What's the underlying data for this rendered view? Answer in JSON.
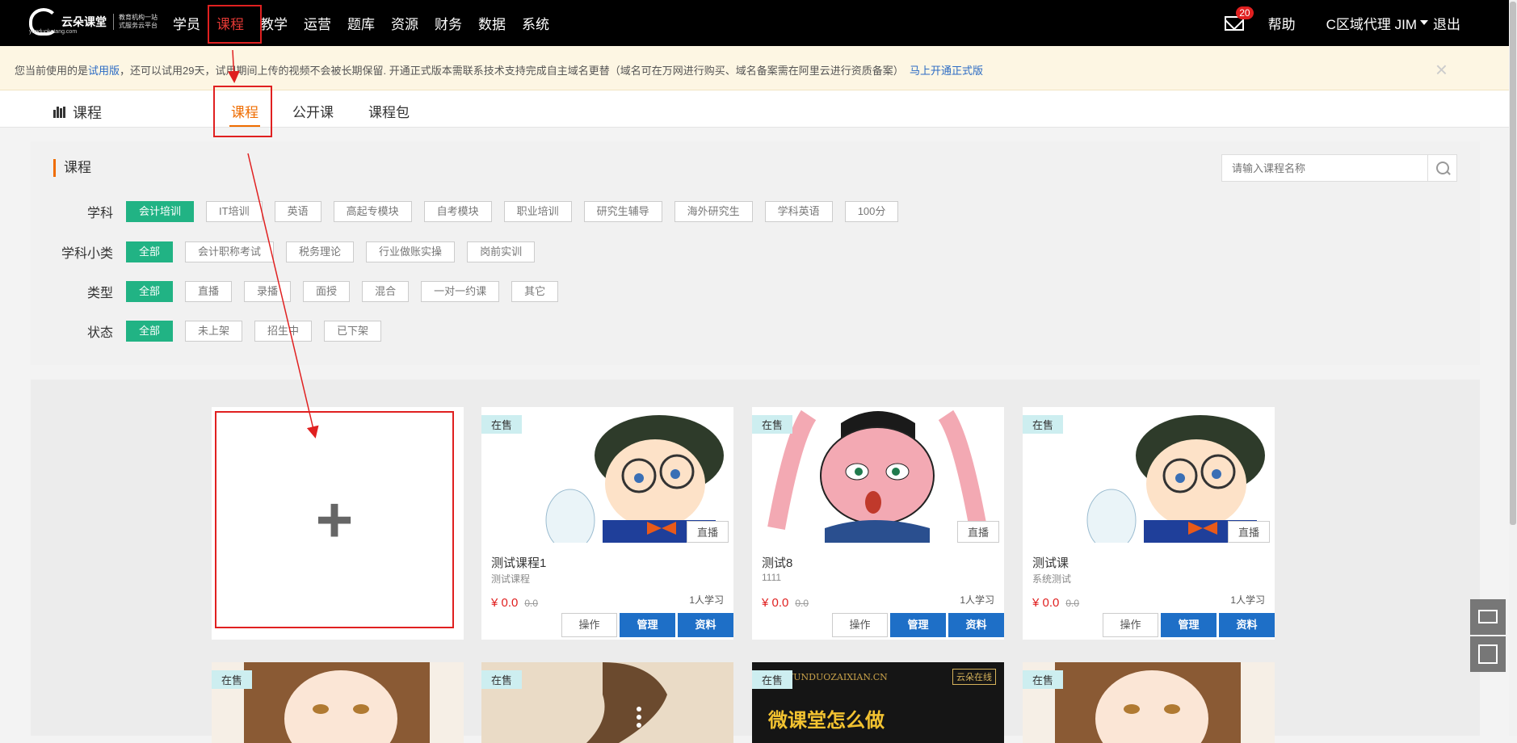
{
  "topbar": {
    "logo_name": "云朵课堂",
    "logo_tagline_1": "教育机构一站",
    "logo_tagline_2": "式服务云平台",
    "logo_url": "yunduoketang.com",
    "nav": [
      "学员",
      "课程",
      "教学",
      "运营",
      "题库",
      "资源",
      "财务",
      "数据",
      "系统"
    ],
    "active_nav": "课程",
    "mail_badge": "20",
    "help": "帮助",
    "user": "C区域代理 JIM",
    "logout": "退出"
  },
  "notice": {
    "part1": "您当前使用的是",
    "trial_link": "试用版",
    "part2": "，还可以试用29天，试用期间上传的视频不会被长期保留. 开通正式版本需联系技术支持完成自主域名更替（域名可在万网进行购买、域名备案需在阿里云进行资质备案）",
    "upgrade_link": "马上开通正式版",
    "close": "×"
  },
  "subnav": {
    "title": "课程",
    "tabs": [
      "课程",
      "公开课",
      "课程包"
    ]
  },
  "filter": {
    "title": "课程",
    "search_placeholder": "请输入课程名称",
    "rows": [
      {
        "label": "学科",
        "chips": [
          "会计培训",
          "IT培训",
          "英语",
          "高起专模块",
          "自考模块",
          "职业培训",
          "研究生辅导",
          "海外研究生",
          "学科英语",
          "100分"
        ]
      },
      {
        "label": "学科小类",
        "chips": [
          "全部",
          "会计职称考试",
          "税务理论",
          "行业做账实操",
          "岗前实训"
        ]
      },
      {
        "label": "类型",
        "chips": [
          "全部",
          "直播",
          "录播",
          "面授",
          "混合",
          "一对一约课",
          "其它"
        ]
      },
      {
        "label": "状态",
        "chips": [
          "全部",
          "未上架",
          "招生中",
          "已下架"
        ]
      }
    ]
  },
  "courses": [
    {
      "tag": "在售",
      "type": "直播",
      "name": "测试课程1",
      "desc": "测试课程",
      "price": "¥ 0.0",
      "orig": "0.0",
      "learners": "1人学习"
    },
    {
      "tag": "在售",
      "type": "直播",
      "name": "测试8",
      "desc": "1111",
      "price": "¥ 0.0",
      "orig": "0.0",
      "learners": "1人学习"
    },
    {
      "tag": "在售",
      "type": "直播",
      "name": "测试课",
      "desc": "系统测试",
      "price": "¥ 0.0",
      "orig": "0.0",
      "learners": "1人学习"
    }
  ],
  "second_row": [
    {
      "tag": "在售"
    },
    {
      "tag": "在售"
    },
    {
      "tag": "在售",
      "banner_url": "YUNDUOZAIXIAN.CN",
      "banner_brand": "云朵在线",
      "banner_title": "微课堂怎么做"
    },
    {
      "tag": "在售"
    }
  ],
  "buttons": {
    "op": "操作",
    "manage": "管理",
    "material": "资料"
  },
  "add_plus": "+",
  "colors": {
    "accent_green": "#21b384",
    "brand_blue": "#1e6fc7",
    "active_orange": "#ef6c00",
    "annotation_red": "#e02020"
  }
}
